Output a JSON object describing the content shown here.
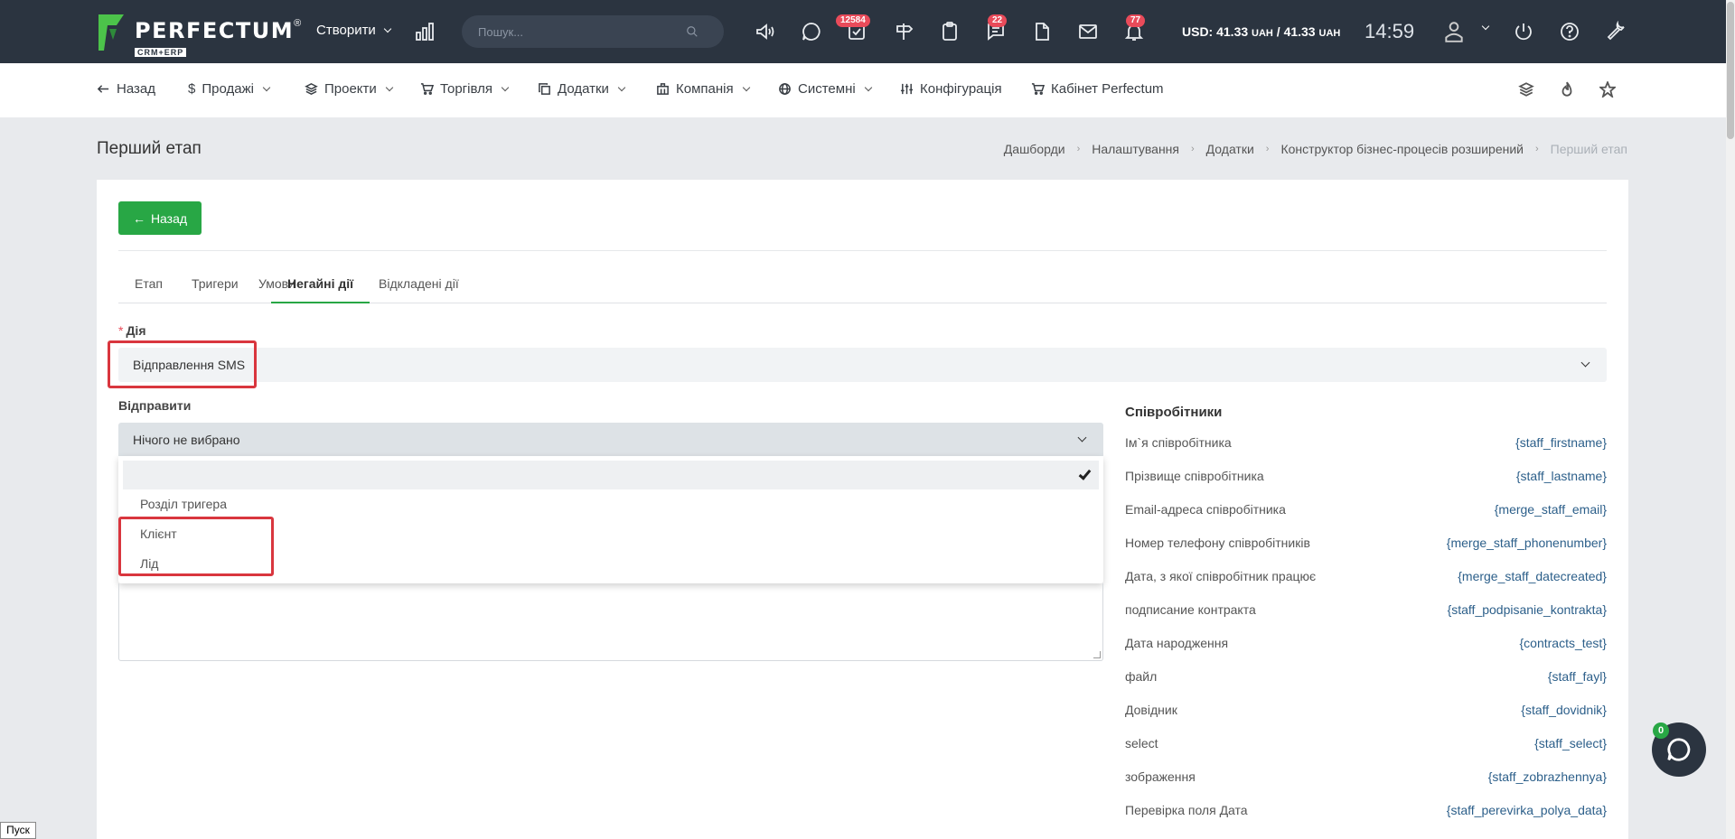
{
  "topbar": {
    "brand": "PERFECTUM",
    "brand_mark": "®",
    "brand_sub": "CRM+ERP",
    "create_label": "Створити",
    "search_placeholder": "Пошук...",
    "badges": {
      "tasks": "12584",
      "messages": "22",
      "notifications": "77"
    },
    "currency": "USD: 41.33",
    "currency_unit": "UAH",
    "currency_sep": " / ",
    "currency_value2": "41.33",
    "time": "14:59"
  },
  "nav": {
    "back": "Назад",
    "sales": "Продажі",
    "projects": "Проекти",
    "trade": "Торгівля",
    "addons": "Додатки",
    "company": "Компанія",
    "system": "Системні",
    "config": "Конфігурація",
    "cabinet": "Кабінет Perfectum"
  },
  "page": {
    "title": "Перший етап",
    "breadcrumb": [
      "Дашборди",
      "Налаштування",
      "Додатки",
      "Конструктор бізнес-процесів розширений",
      "Перший етап"
    ]
  },
  "panel": {
    "back_button": "Назад",
    "tabs": [
      "Етап",
      "Тригери",
      "Умови",
      "Негайні дії",
      "Відкладені дії"
    ],
    "action_label": "Дія",
    "action_value": "Відправлення SMS",
    "send_label": "Відправити",
    "send_value": "Нічого не вибрано",
    "dropdown_options": [
      "Розділ тригера",
      "Клієнт",
      "Лід"
    ]
  },
  "vars": {
    "title": "Співробітники",
    "rows": [
      {
        "k": "Ім`я співробітника",
        "v": "{staff_firstname}"
      },
      {
        "k": "Прізвище співробітника",
        "v": "{staff_lastname}"
      },
      {
        "k": "Email-адреса співробітника",
        "v": "{merge_staff_email}"
      },
      {
        "k": "Номер телефону співробітників",
        "v": "{merge_staff_phonenumber}"
      },
      {
        "k": "Дата, з якої співробітник працює",
        "v": "{merge_staff_datecreated}"
      },
      {
        "k": "подписание контракта",
        "v": "{staff_podpisanie_kontrakta}"
      },
      {
        "k": "Дата народження",
        "v": "{contracts_test}"
      },
      {
        "k": "файл",
        "v": "{staff_fayl}"
      },
      {
        "k": "Довідник",
        "v": "{staff_dovidnik}"
      },
      {
        "k": "select",
        "v": "{staff_select}"
      },
      {
        "k": "зображення",
        "v": "{staff_zobrazhennya}"
      },
      {
        "k": "Перевірка поля Дата",
        "v": "{staff_perevirka_polya_data}"
      }
    ]
  },
  "chat_badge": "0",
  "taskbar_start": "Пуск"
}
